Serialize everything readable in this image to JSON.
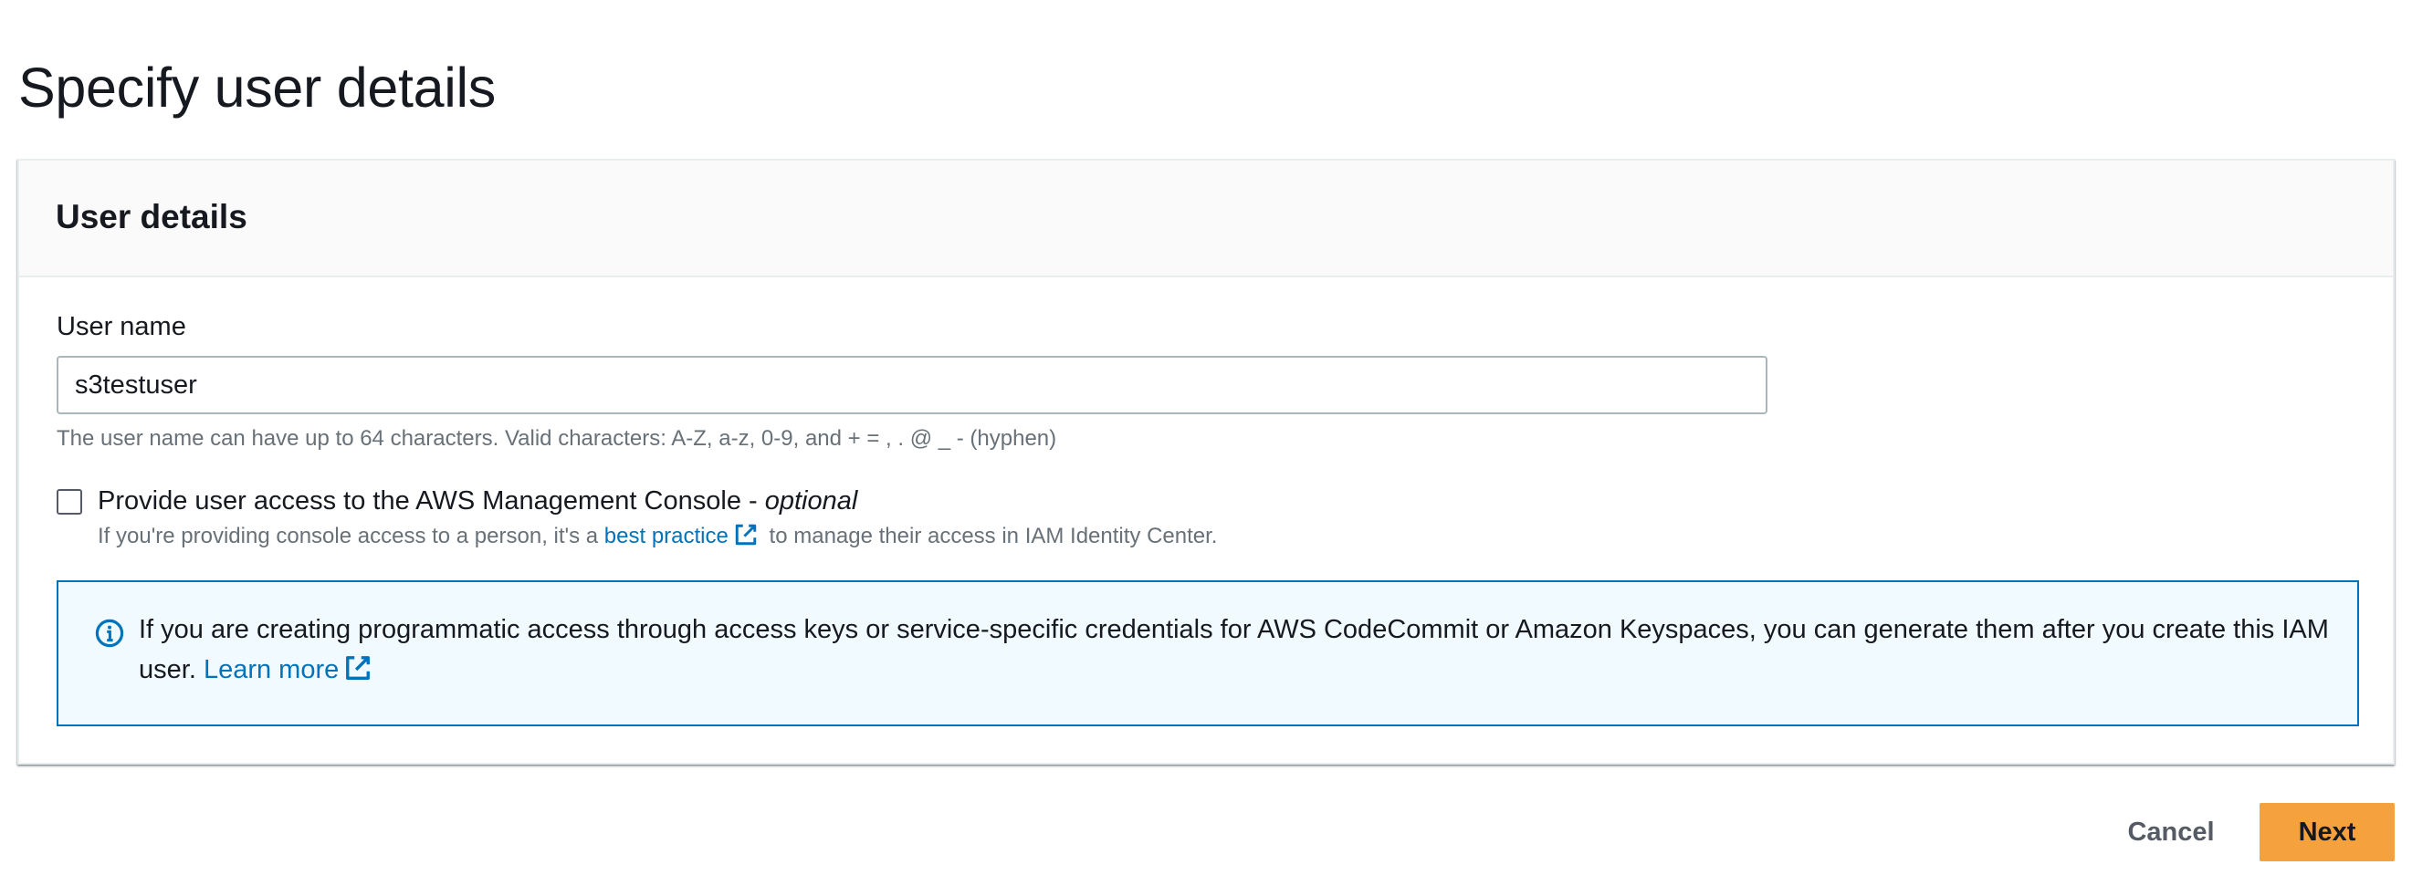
{
  "page": {
    "title": "Specify user details"
  },
  "user_details": {
    "section_title": "User details",
    "username_label": "User name",
    "username_value": "s3testuser",
    "username_hint": "The user name can have up to 64 characters. Valid characters: A-Z, a-z, 0-9, and + = , . @ _ - (hyphen)",
    "console_access": {
      "checked": false,
      "label_prefix": "Provide user access to the AWS Management Console - ",
      "label_optional": "optional",
      "desc_before": "If you're providing console access to a person, it's a ",
      "desc_link": "best practice",
      "desc_after": " to manage their access in IAM Identity Center."
    },
    "info_alert": {
      "text": "If you are creating programmatic access through access keys or service-specific credentials for AWS CodeCommit or Amazon Keyspaces, you can generate them after you create this IAM user. ",
      "link": "Learn more"
    }
  },
  "actions": {
    "cancel_label": "Cancel",
    "next_label": "Next"
  },
  "colors": {
    "link": "#0073bb",
    "primary_button": "#f4a13e",
    "info_border": "#0073bb",
    "info_background": "#f1faff"
  },
  "icons": {
    "external_link": "external-link-icon",
    "info": "info-circle-icon"
  }
}
